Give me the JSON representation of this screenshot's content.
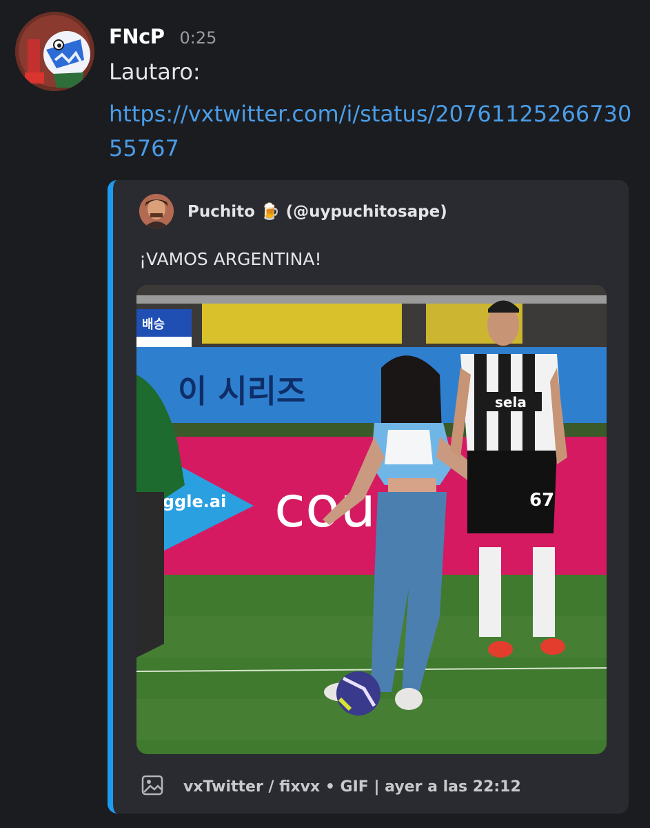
{
  "message": {
    "username": "FNcP",
    "time": "0:25",
    "text": "Lautaro:",
    "link": "https://vxtwitter.com/i/status/2076112526673055767"
  },
  "embed": {
    "accent_color": "#1d9bf0",
    "author": "Puchito 🍺 (@uypuchitosape)",
    "description": "¡VAMOS ARGENTINA!",
    "media": {
      "banner_text": "이 시리즈",
      "sponsor_left": "viggle.ai",
      "sponsor_right": "cou",
      "scoreboard": "배승",
      "shirt_sponsor": "sela",
      "player_number": "67"
    },
    "footer": "vxTwitter / fixvx • GIF | ayer a las 22:12",
    "footer_icon": "image-icon"
  }
}
